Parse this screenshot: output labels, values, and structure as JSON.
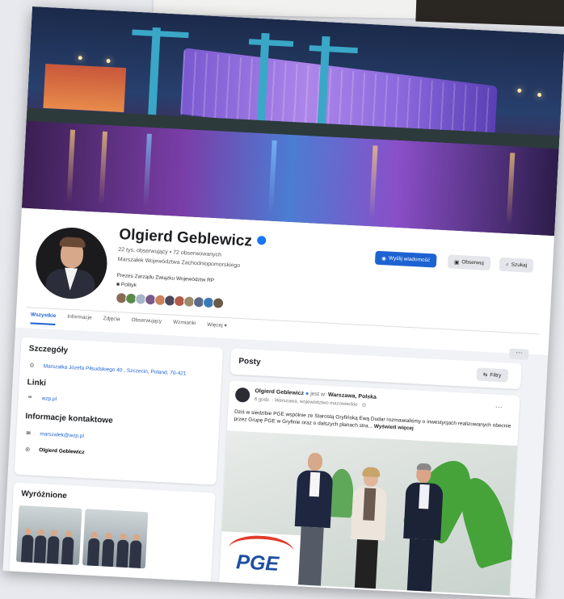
{
  "profile": {
    "name": "Olgierd Geblewicz",
    "stats": "22 tys. obserwujący • 72 obserwowanych",
    "role": "Marszałek Województwa Zachodniopomorskiego",
    "bio": "Prezes Zarządu Związku Województw RP",
    "category": "Polityk"
  },
  "actions": {
    "message": "Wyślij wiadomość",
    "follow": "Obserwuj",
    "search": "Szukaj"
  },
  "tabs": [
    "Wszystkie",
    "Informacje",
    "Zdjęcia",
    "Obserwujący",
    "Wzmianki",
    "Więcej ▾"
  ],
  "more_button": "···",
  "details": {
    "title": "Szczegóły",
    "address": "Marszałka Józefa Piłsudskiego 40 , Szczecin, Poland, 70-421",
    "links_title": "Linki",
    "website": "wzp.pl",
    "contact_title": "Informacje kontaktowe",
    "email": "marszalek@wzp.pl",
    "messenger": "Olgierd Geblewicz"
  },
  "featured": {
    "title": "Wyróżnione"
  },
  "posts": {
    "title": "Posty",
    "filter": "Filtry",
    "author": "Olgierd Geblewicz",
    "location_prefix": "jest w:",
    "location": "Warszawa, Polska",
    "meta": "6 godz. · Warszawa, województwo mazowieckie · ◎",
    "text": "Dziś w siedzibie PGE wspólnie ze Starostą Gryfińską Ewą Dudar rozmawialiśmy o inwestycjach realizowanych obecnie przez Grupę PGE w Gryfinie oraz o dalszych planach stra...",
    "see_more": "Wyświetl więcej",
    "photo_brand": "PGE"
  },
  "colors": {
    "accent": "#1d62d1",
    "background": "#f0f2f5",
    "verified": "#1877f2"
  },
  "icons": [
    "verified-icon",
    "messenger-icon",
    "follow-icon",
    "search-icon",
    "location-icon",
    "link-icon",
    "email-icon",
    "messenger-contact-icon",
    "filter-icon"
  ]
}
